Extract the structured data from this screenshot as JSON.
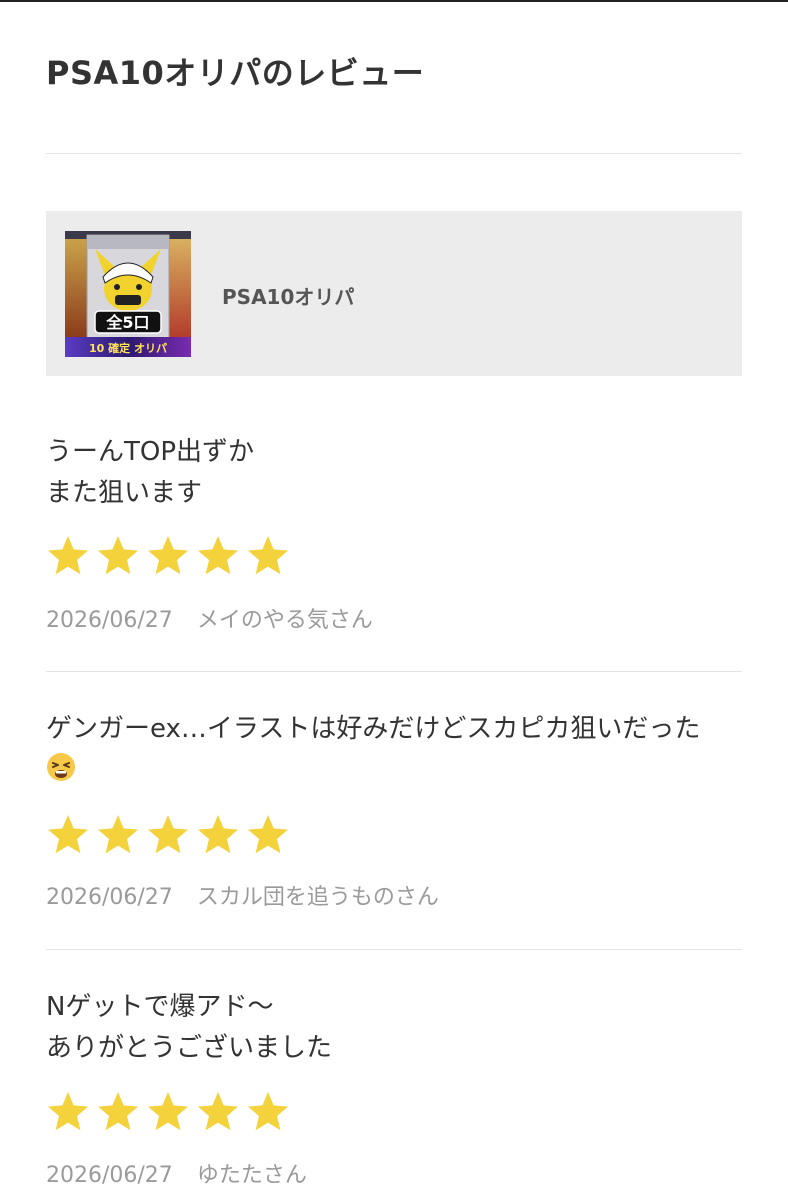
{
  "page": {
    "title": "PSA10オリパのレビュー"
  },
  "product": {
    "name": "PSA10オリパ",
    "thumbnail_text": "全5口",
    "thumbnail_banner": "10 確定 オリパ"
  },
  "colors": {
    "star": "#f3d23b",
    "meta": "#9a9a9a",
    "card_bg": "#ececec",
    "divider": "#e4e4e4"
  },
  "reviews": [
    {
      "text": "うーんTOP出ずか\nまた狙います",
      "rating": 5,
      "date": "2026/06/27",
      "author": "メイのやる気さん"
    },
    {
      "text": "ゲンガーex…イラストは好みだけどスカピカ狙いだった",
      "emoji": "tired-face-emoji",
      "rating": 5,
      "date": "2026/06/27",
      "author": "スカル団を追うものさん"
    },
    {
      "text": "Nゲットで爆アド〜\nありがとうございました",
      "rating": 5,
      "date": "2026/06/27",
      "author": "ゆたたさん"
    }
  ]
}
